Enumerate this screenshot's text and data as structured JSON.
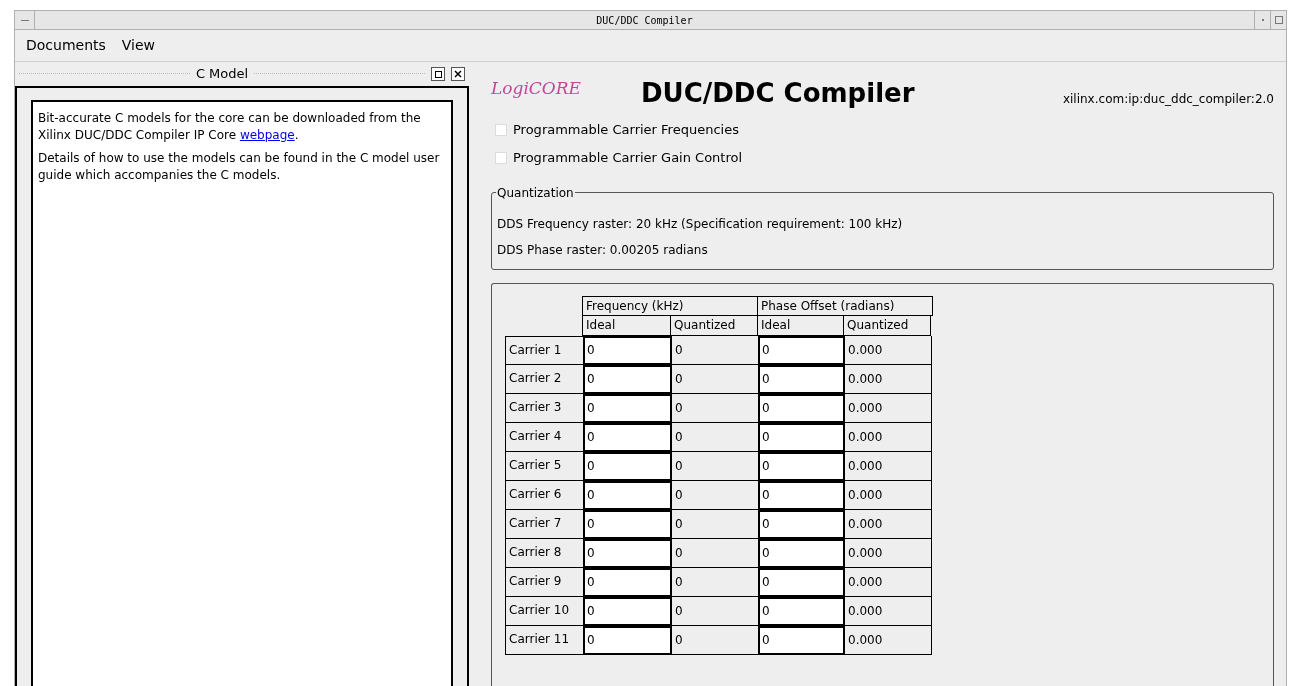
{
  "window": {
    "title": "DUC/DDC Compiler"
  },
  "menu": [
    "Documents",
    "View"
  ],
  "side_panel": {
    "title": "C Model",
    "paragraphs": [
      {
        "text": "Bit-accurate C models for the core can be downloaded from the Xilinx DUC/DDC Compiler IP Core ",
        "link": "webpage",
        "after": "."
      },
      {
        "text": "Details of how to use the models can be found in the C model user guide which accompanies the C models."
      }
    ]
  },
  "header": {
    "logo": "LogiCORE",
    "title": "DUC/DDC Compiler",
    "ip_id": "xilinx.com:ip:duc_ddc_compiler:2.0"
  },
  "options": [
    {
      "label": "Programmable Carrier Frequencies",
      "checked": false
    },
    {
      "label": "Programmable Carrier Gain Control",
      "checked": false
    }
  ],
  "quantization": {
    "title": "Quantization",
    "lines": [
      "DDS Frequency raster: 20 kHz (Specification requirement: 100 kHz)",
      "DDS Phase raster: 0.00205 radians"
    ]
  },
  "table": {
    "groups": [
      "Frequency (kHz)",
      "Phase Offset (radians)"
    ],
    "columns": [
      "Ideal",
      "Quantized",
      "Ideal",
      "Quantized"
    ],
    "rows": [
      {
        "label": "Carrier 1",
        "cells": [
          "0",
          "0",
          "0",
          "0.000"
        ]
      },
      {
        "label": "Carrier 2",
        "cells": [
          "0",
          "0",
          "0",
          "0.000"
        ]
      },
      {
        "label": "Carrier 3",
        "cells": [
          "0",
          "0",
          "0",
          "0.000"
        ]
      },
      {
        "label": "Carrier 4",
        "cells": [
          "0",
          "0",
          "0",
          "0.000"
        ]
      },
      {
        "label": "Carrier 5",
        "cells": [
          "0",
          "0",
          "0",
          "0.000"
        ]
      },
      {
        "label": "Carrier 6",
        "cells": [
          "0",
          "0",
          "0",
          "0.000"
        ]
      },
      {
        "label": "Carrier 7",
        "cells": [
          "0",
          "0",
          "0",
          "0.000"
        ]
      },
      {
        "label": "Carrier 8",
        "cells": [
          "0",
          "0",
          "0",
          "0.000"
        ]
      },
      {
        "label": "Carrier 9",
        "cells": [
          "0",
          "0",
          "0",
          "0.000"
        ]
      },
      {
        "label": "Carrier 10",
        "cells": [
          "0",
          "0",
          "0",
          "0.000"
        ]
      },
      {
        "label": "Carrier 11",
        "cells": [
          "0",
          "0",
          "0",
          "0.000"
        ]
      }
    ]
  }
}
